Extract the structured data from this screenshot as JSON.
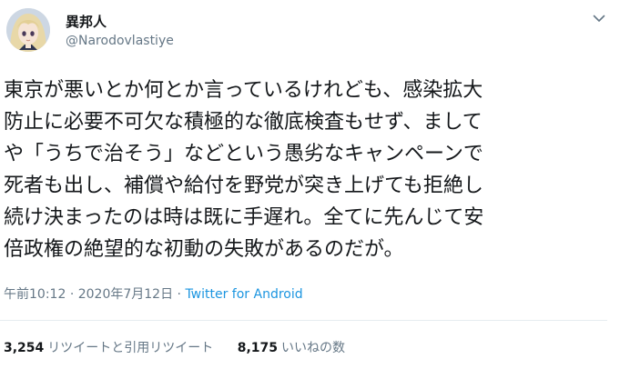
{
  "header": {
    "display_name": "異邦人",
    "handle": "@Narodovlastiye",
    "avatar_icon": "anime-avatar",
    "menu_icon": "chevron-down-icon"
  },
  "tweet": {
    "lines": [
      "東京が悪いとか何とか言っているけれども、感染拡大",
      "防止に必要不可欠な積極的な徹底検査もせず、まして",
      "や「うちで治そう」などという愚劣なキャンペーンで",
      "死者も出し、補償や給付を野党が突き上げても拒絶し",
      "続け決まったのは時は既に手遅れ。全てに先んじて安",
      "倍政権の絶望的な初動の失敗があるのだが。"
    ]
  },
  "meta": {
    "time": "午前10:12",
    "separator1": "·",
    "date": "2020年7月12日",
    "separator2": "·",
    "source": "Twitter for Android"
  },
  "stats": {
    "retweets_count": "3,254",
    "retweets_label": "リツイートと引用リツイート",
    "likes_count": "8,175",
    "likes_label": "いいねの数"
  },
  "colors": {
    "text": "#14171a",
    "secondary": "#657786",
    "link": "#1b95e0",
    "divider": "#e6ecf0"
  }
}
